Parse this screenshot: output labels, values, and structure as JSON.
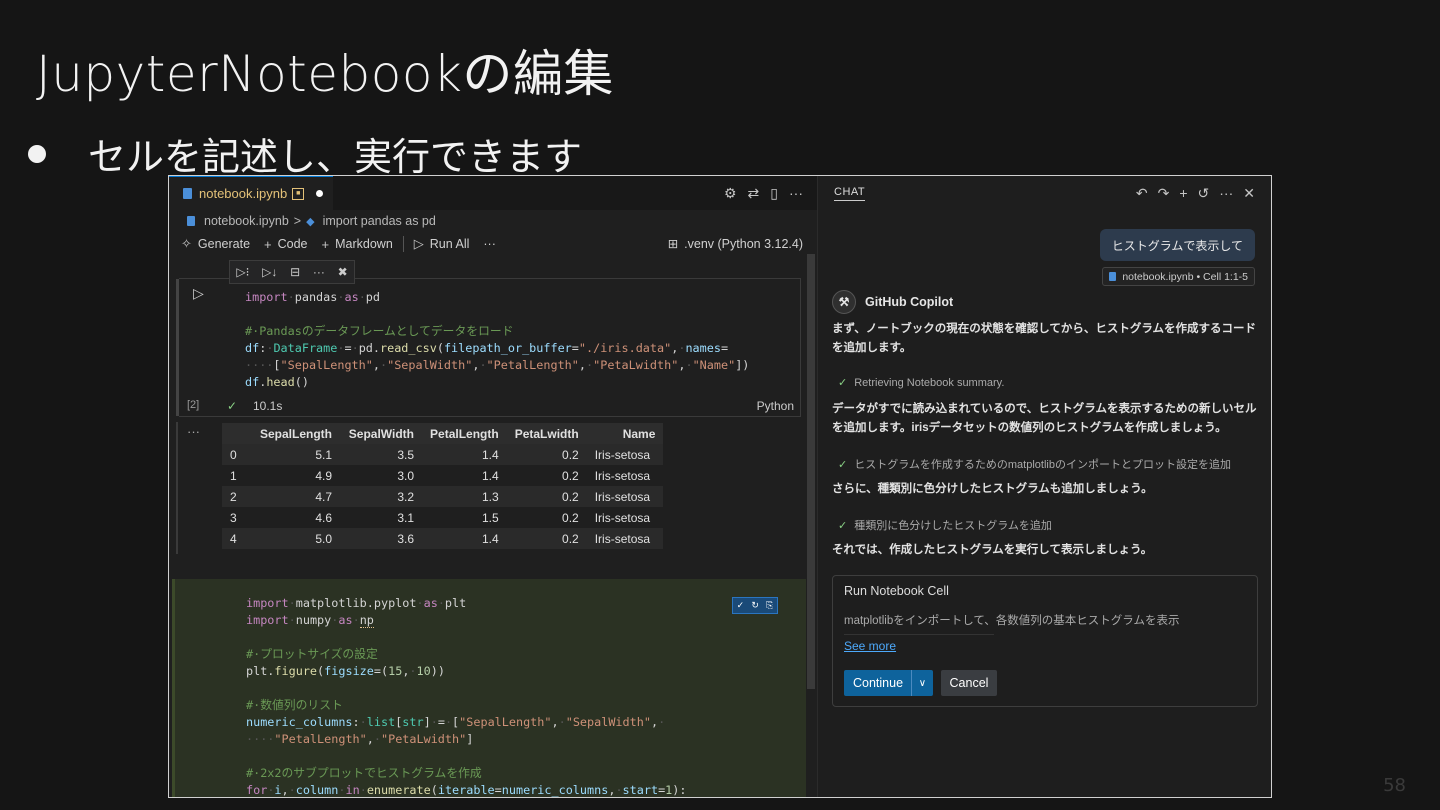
{
  "slide": {
    "title": "JupyterNotebookの編集",
    "bullet": "セルを記述し、実行できます",
    "page_number": "58"
  },
  "editor": {
    "tab_label": "notebook.ipynb",
    "tab_modified_glyph": "●",
    "tab_icons": [
      "⚙",
      "⇄",
      "▯",
      "···"
    ],
    "breadcrumb": {
      "file": "notebook.ipynb",
      "separator": ">",
      "symbol": "import pandas as pd"
    },
    "toolbar": {
      "generate": "Generate",
      "code": "Code",
      "markdown": "Markdown",
      "run_all": "Run All",
      "more": "···",
      "kernel": ".venv (Python 3.12.4)"
    },
    "cell_toolbar": [
      "▷⁝",
      "▷↓",
      "⊟",
      "···",
      "🗑"
    ],
    "cell1": {
      "exec_count": "[2]",
      "duration": "10.1s",
      "language": "Python",
      "check": "✓"
    },
    "output_more": "···",
    "table": {
      "headers": [
        "",
        "SepalLength",
        "SepalWidth",
        "PetalLength",
        "PetaLwidth",
        "Name"
      ],
      "rows": [
        [
          "0",
          "5.1",
          "3.5",
          "1.4",
          "0.2",
          "Iris-setosa"
        ],
        [
          "1",
          "4.9",
          "3.0",
          "1.4",
          "0.2",
          "Iris-setosa"
        ],
        [
          "2",
          "4.7",
          "3.2",
          "1.3",
          "0.2",
          "Iris-setosa"
        ],
        [
          "3",
          "4.6",
          "3.1",
          "1.5",
          "0.2",
          "Iris-setosa"
        ],
        [
          "4",
          "5.0",
          "3.6",
          "1.4",
          "0.2",
          "Iris-setosa"
        ]
      ]
    },
    "inline_buttons": [
      "✓",
      "↻",
      "⎘"
    ]
  },
  "chat": {
    "title": "CHAT",
    "header_icons": [
      "↶",
      "↷",
      "+",
      "↺",
      "···",
      "✕"
    ],
    "user_message": "ヒストグラムで表示して",
    "reference_chip": "notebook.ipynb • Cell 1:1-5",
    "assistant_name": "GitHub Copilot",
    "assistant_icon": "wrench-icon",
    "msg1": "まず、ノートブックの現在の状態を確認してから、ヒストグラムを作成するコードを追加します。",
    "step1": "Retrieving Notebook summary.",
    "msg2": "データがすでに読み込まれているので、ヒストグラムを表示するための新しいセルを追加します。irisデータセットの数値列のヒストグラムを作成しましょう。",
    "step2": "ヒストグラムを作成するためのmatplotlibのインポートとプロット設定を追加",
    "msg3": "さらに、種類別に色分けしたヒストグラムも追加しましょう。",
    "step3": "種類別に色分けしたヒストグラムを追加",
    "msg4": "それでは、作成したヒストグラムを実行して表示しましょう。",
    "confirm": {
      "title": "Run Notebook Cell",
      "description": "matplotlibをインポートして、各数値列の基本ヒストグラムを表示",
      "see_more": "See more",
      "continue": "Continue",
      "cancel": "Cancel"
    }
  },
  "colors": {
    "accent": "#0078d4",
    "tab_text": "#e3c178",
    "success": "#89d185",
    "link": "#4daafc",
    "continue_button": "#0e639c"
  }
}
